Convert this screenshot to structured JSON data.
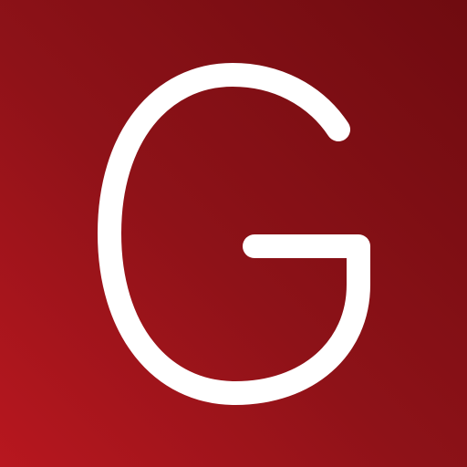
{
  "icon": {
    "name": "G app icon",
    "letter": "G",
    "colors": {
      "background_start": "#b8171f",
      "background_end": "#6f0b10",
      "glyph": "#ffffff"
    }
  }
}
